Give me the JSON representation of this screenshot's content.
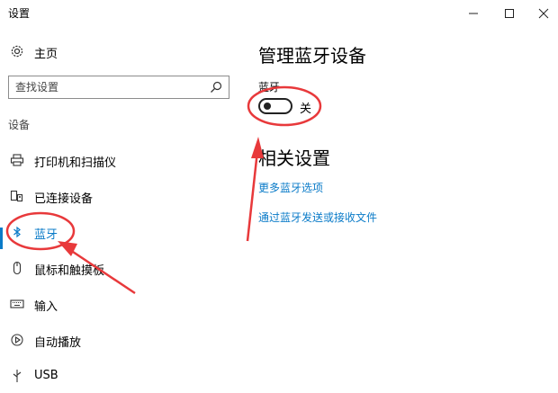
{
  "window": {
    "title": "设置",
    "minimize_glyph": "—",
    "maximize_glyph": "☐",
    "close_glyph": "✕"
  },
  "sidebar": {
    "home": {
      "label": "主页",
      "icon": "gear-icon"
    },
    "search": {
      "placeholder": "查找设置",
      "icon": "search-icon"
    },
    "section_label": "设备",
    "items": [
      {
        "label": "打印机和扫描仪",
        "icon": "printer-icon",
        "active": false
      },
      {
        "label": "已连接设备",
        "icon": "devices-icon",
        "active": false
      },
      {
        "label": "蓝牙",
        "icon": "bluetooth-icon",
        "active": true
      },
      {
        "label": "鼠标和触摸板",
        "icon": "mouse-icon",
        "active": false
      },
      {
        "label": "输入",
        "icon": "keyboard-icon",
        "active": false
      },
      {
        "label": "自动播放",
        "icon": "autoplay-icon",
        "active": false
      },
      {
        "label": "USB",
        "icon": "usb-icon",
        "active": false
      }
    ]
  },
  "main": {
    "title": "管理蓝牙设备",
    "bluetooth_label": "蓝牙",
    "toggle_state_text": "关",
    "toggle_on": false,
    "related_title": "相关设置",
    "links": [
      "更多蓝牙选项",
      "通过蓝牙发送或接收文件"
    ]
  },
  "colors": {
    "accent": "#0a7bc8",
    "annotation": "#e8393b"
  }
}
